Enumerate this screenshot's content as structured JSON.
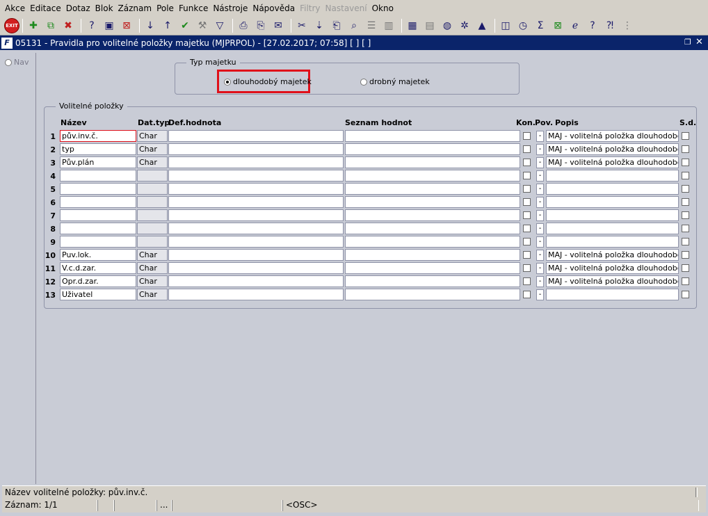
{
  "menu": [
    "Akce",
    "Editace",
    "Dotaz",
    "Blok",
    "Záznam",
    "Pole",
    "Funkce",
    "Nástroje",
    "Nápověda",
    "Filtry",
    "Nastavení",
    "Okno"
  ],
  "menu_disabled": [
    "Filtry",
    "Nastavení"
  ],
  "toolbar": {
    "exit_label": "EXIT",
    "icons": [
      "new-record-icon",
      "duplicate-record-icon",
      "delete-record-icon",
      "query-icon",
      "execute-query-icon",
      "cancel-query-icon",
      "sort-asc-icon",
      "sort-desc-icon",
      "commit-icon",
      "tools-icon",
      "filter-icon",
      "print-icon",
      "print-preview-icon",
      "mail-icon",
      "cut-icon",
      "paste-icon",
      "copy-icon",
      "find-icon",
      "list-icon",
      "columns-icon",
      "calculator-icon",
      "report-icon",
      "globe-icon",
      "settings-icon",
      "up-icon",
      "chart-icon",
      "clock-icon",
      "sum-icon",
      "excel-icon",
      "ie-icon",
      "help-icon",
      "whatsthis-icon",
      "options-icon"
    ]
  },
  "window": {
    "title": "05131 - Pravidla pro volitelné položky majetku (MJPRPOL) - [27.02.2017; 07:58]  [ ] [ ]",
    "icon_letter": "F"
  },
  "nav": {
    "label": "Nav"
  },
  "typ_majetku": {
    "legend": "Typ majetku",
    "options": [
      {
        "label": "dlouhodobý majetek",
        "selected": true
      },
      {
        "label": "drobný majetek",
        "selected": false
      }
    ]
  },
  "volitelne": {
    "legend": "Volitelné položky",
    "headers": {
      "nazev": "Název",
      "dattyp": "Dat.typ",
      "defhodnota": "Def.hodnota",
      "seznam": "Seznam hodnot",
      "kon": "Kon.",
      "pov": "Pov.",
      "popis": "Popis",
      "sd": "S.d."
    },
    "rows": [
      {
        "num": "1",
        "nazev": "pův.inv.č.",
        "dattyp": "Char",
        "def": "",
        "seznam": "",
        "pov": "-",
        "popis": "MAJ - volitelná položka dlouhodobého m"
      },
      {
        "num": "2",
        "nazev": "typ",
        "dattyp": "Char",
        "def": "",
        "seznam": "",
        "pov": "-",
        "popis": "MAJ - volitelná položka dlouhodobého m"
      },
      {
        "num": "3",
        "nazev": "Pův.plán",
        "dattyp": "Char",
        "def": "",
        "seznam": "",
        "pov": "-",
        "popis": "MAJ - volitelná položka dlouhodobého m"
      },
      {
        "num": "4",
        "nazev": "",
        "dattyp": "",
        "def": "",
        "seznam": "",
        "pov": "-",
        "popis": ""
      },
      {
        "num": "5",
        "nazev": "",
        "dattyp": "",
        "def": "",
        "seznam": "",
        "pov": "-",
        "popis": ""
      },
      {
        "num": "6",
        "nazev": "",
        "dattyp": "",
        "def": "",
        "seznam": "",
        "pov": "-",
        "popis": ""
      },
      {
        "num": "7",
        "nazev": "",
        "dattyp": "",
        "def": "",
        "seznam": "",
        "pov": "-",
        "popis": ""
      },
      {
        "num": "8",
        "nazev": "",
        "dattyp": "",
        "def": "",
        "seznam": "",
        "pov": "-",
        "popis": ""
      },
      {
        "num": "9",
        "nazev": "",
        "dattyp": "",
        "def": "",
        "seznam": "",
        "pov": "-",
        "popis": ""
      },
      {
        "num": "10",
        "nazev": "Puv.lok.",
        "dattyp": "Char",
        "def": "",
        "seznam": "",
        "pov": "-",
        "popis": "MAJ - volitelná položka dlouhodobého m"
      },
      {
        "num": "11",
        "nazev": "V.c.d.zar.",
        "dattyp": "Char",
        "def": "",
        "seznam": "",
        "pov": "-",
        "popis": "MAJ - volitelná položka dlouhodobého m"
      },
      {
        "num": "12",
        "nazev": "Opr.d.zar.",
        "dattyp": "Char",
        "def": "",
        "seznam": "",
        "pov": "-",
        "popis": "MAJ - volitelná položka dlouhodobého m"
      },
      {
        "num": "13",
        "nazev": "Uživatel",
        "dattyp": "Char",
        "def": "",
        "seznam": "",
        "pov": "-",
        "popis": ""
      }
    ]
  },
  "status": {
    "hint": "Název volitelné položky: pův.inv.č.",
    "record": "Záznam: 1/1",
    "seg_dots": "...",
    "osc": "<OSC>"
  },
  "colors": {
    "titlebar": "#0a246a",
    "highlight": "#e0101a",
    "background": "#c9ccd6"
  }
}
